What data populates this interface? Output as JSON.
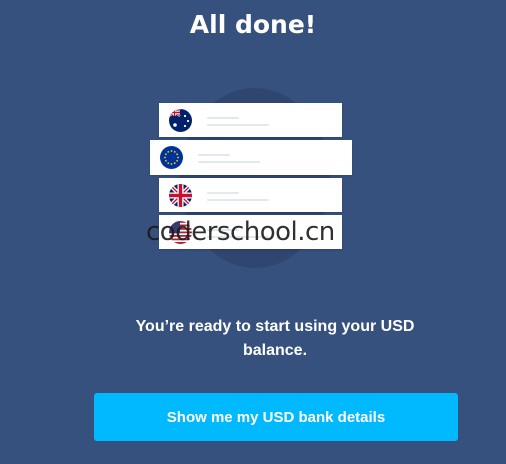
{
  "title": "All done!",
  "illustration": {
    "cards": [
      {
        "currency": "AUD",
        "flag_icon": "australia-flag-icon"
      },
      {
        "currency": "EUR",
        "flag_icon": "eu-flag-icon"
      },
      {
        "currency": "GBP",
        "flag_icon": "uk-flag-icon"
      },
      {
        "currency": "USD",
        "flag_icon": "us-flag-icon"
      }
    ]
  },
  "watermark": "coderschool.cn",
  "message": {
    "line1": "You’re ready to start using your USD",
    "line2": "balance."
  },
  "cta": {
    "label": "Show me my USD bank details"
  },
  "colors": {
    "background": "#37517e",
    "button": "#00b9ff",
    "text": "#ffffff"
  }
}
